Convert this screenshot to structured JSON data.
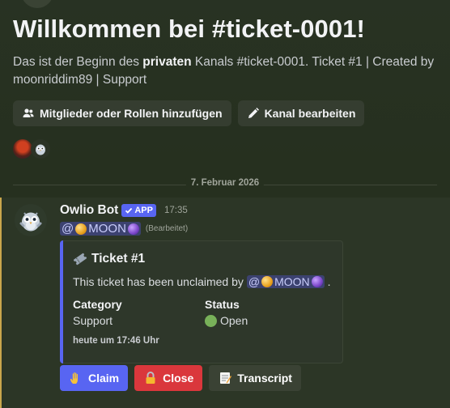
{
  "channel": {
    "welcome_title": "Willkommen bei #ticket-0001!",
    "desc_prefix": "Das ist der Beginn des ",
    "desc_bold": "privaten",
    "desc_suffix": " Kanals #ticket-0001. Ticket #1 | Created by moonriddim89 | Support",
    "add_members_label": "Mitglieder oder Rollen hinzufügen",
    "edit_channel_label": "Kanal bearbeiten"
  },
  "date_divider": "7. Februar 2026",
  "message": {
    "author": "Owlio Bot",
    "app_badge": "APP",
    "time": "17:35",
    "mention_prefix": "@",
    "mention_name": "MOON",
    "edited": "(Bearbeitet)"
  },
  "embed": {
    "title": "Ticket #1",
    "description_prefix": "This ticket has been unclaimed by",
    "mention_prefix": "@",
    "mention_name": "MOON",
    "description_suffix": ".",
    "fields": [
      {
        "name": "Category",
        "value": "Support"
      },
      {
        "name": "Status",
        "value": "Open"
      }
    ],
    "footer": "heute um 17:46 Uhr"
  },
  "actions": {
    "claim_label": "Claim",
    "close_label": "Close",
    "transcript_label": "Transcript"
  },
  "icons": {
    "add_members": "people-add-icon",
    "edit": "pencil-icon",
    "ticket": "ticket-icon",
    "check": "checkmark-icon",
    "claim": "raised-hand-icon",
    "close": "lock-icon",
    "transcript": "memo-icon"
  },
  "colors": {
    "blurple": "#5865f2",
    "danger": "#da373c",
    "mention_bg": "#3c4270",
    "highlight_bar": "#c9a64c",
    "status_green": "#78b159"
  }
}
